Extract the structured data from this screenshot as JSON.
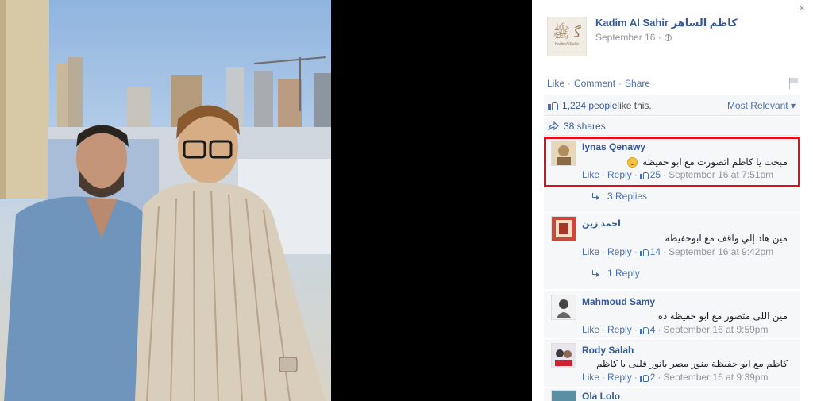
{
  "post": {
    "page_name": "Kadim Al Sahir كاظم الساهر",
    "date": "September 16 ·",
    "avatar_caption": "KadimAlSahir",
    "actions": [
      "Like",
      "Comment",
      "Share"
    ],
    "actions_sep": "·"
  },
  "stats": {
    "likes_count": "1,224 people",
    "likes_suffix": " like this.",
    "sort_label": "Most Relevant ▾",
    "shares": "38 shares"
  },
  "comments": [
    {
      "name": "Iynas Qenawy",
      "text": "مبخت يا كاظم اتصورت مع ابو حفيظه",
      "emoji": "smile-icon",
      "like": "Like",
      "reply": "Reply",
      "likes": "25",
      "time": "September 16 at 7:51pm",
      "replies": "3 Replies"
    },
    {
      "name": "احمد زين",
      "text": "مين هاد إلي واقف مع ابوحفيظة",
      "like": "Like",
      "reply": "Reply",
      "likes": "14",
      "time": "September 16 at 9:42pm",
      "replies": "1 Reply"
    },
    {
      "name": "Mahmoud Samy",
      "text": "مين اللى متصور مع ابو حفيظه ده",
      "like": "Like",
      "reply": "Reply",
      "likes": "4",
      "time": "September 16 at 9:59pm"
    },
    {
      "name": "Rody Salah",
      "text": "كاظم مع ابو حفيظة منور مصر يانور قلبى يا كاظم",
      "like": "Like",
      "reply": "Reply",
      "likes": "2",
      "time": "September 16 at 9:39pm"
    },
    {
      "name": "Ola Lolo"
    }
  ],
  "ui": {
    "close_glyph": "×",
    "sep": "·",
    "highlight_color": "#e0101a",
    "link_color": "#365899",
    "panel_bg": "#f6f7f9"
  }
}
